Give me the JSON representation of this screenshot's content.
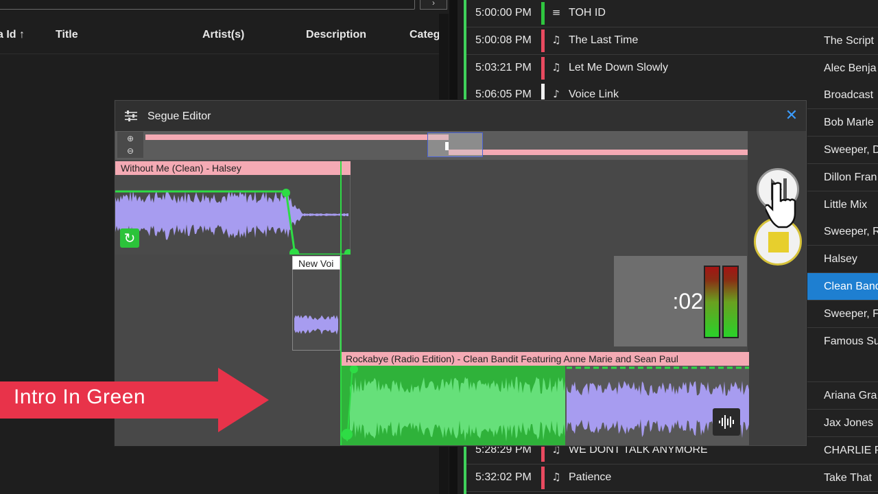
{
  "library": {
    "columns": [
      "a Id ↑",
      "Title",
      "Artist(s)",
      "Description",
      "Categ"
    ],
    "search_button": "›"
  },
  "playlist": {
    "rows": [
      {
        "time": "5:00:00 PM",
        "title": "TOH ID",
        "artist": "",
        "bar": "#2fc53f",
        "icon": "antenna-icon"
      },
      {
        "time": "5:00:08 PM",
        "title": "The Last Time",
        "artist": "The Script",
        "bar": "#e84a5f",
        "icon": "music-note-icon"
      },
      {
        "time": "5:03:21 PM",
        "title": "Let Me Down Slowly",
        "artist": "Alec Benja",
        "bar": "#e84a5f",
        "icon": "music-note-icon"
      },
      {
        "time": "5:06:05 PM",
        "title": "Voice Link",
        "artist": "Broadcast",
        "bar": "#f0f0f0",
        "icon": "microphone-icon"
      },
      {
        "time": "",
        "title": "",
        "artist": "Bob Marle",
        "bar": "",
        "icon": ""
      },
      {
        "time": "",
        "title": "",
        "artist": "Sweeper, D",
        "bar": "",
        "icon": ""
      },
      {
        "time": "",
        "title": "",
        "artist": "Dillon Fran",
        "bar": "",
        "icon": ""
      },
      {
        "time": "",
        "title": "",
        "artist": "Little Mix",
        "bar": "",
        "icon": ""
      },
      {
        "time": "",
        "title": "",
        "artist": "Sweeper, R",
        "bar": "",
        "icon": ""
      },
      {
        "time": "",
        "title": "",
        "artist": "Halsey",
        "bar": "",
        "icon": ""
      },
      {
        "time": "",
        "title": "",
        "artist": "Clean Band",
        "bar": "",
        "icon": ""
      },
      {
        "time": "",
        "title": "",
        "artist": "Sweeper, F",
        "bar": "",
        "icon": ""
      },
      {
        "time": "",
        "title": "",
        "artist": "Famous Su",
        "bar": "",
        "icon": ""
      },
      {
        "time": "",
        "title": "",
        "artist": "",
        "bar": "",
        "icon": ""
      },
      {
        "time": "",
        "title": "",
        "artist": "Ariana Gra",
        "bar": "",
        "icon": ""
      },
      {
        "time": "",
        "title": "",
        "artist": "Jax Jones",
        "bar": "",
        "icon": ""
      },
      {
        "time": "5:28:29 PM",
        "title": "WE DONT TALK ANYMORE",
        "artist": "CHARLIE P",
        "bar": "#e84a5f",
        "icon": "music-note-icon"
      },
      {
        "time": "5:32:02 PM",
        "title": "Patience",
        "artist": "Take That",
        "bar": "#e84a5f",
        "icon": "music-note-icon"
      }
    ],
    "selected_index": 10
  },
  "segue": {
    "title": "Segue Editor",
    "close": "✕",
    "track1_label": "Without Me (Clean) - Halsey",
    "track2_label": "New Voi",
    "track3_label": "Rockabye (Radio Edition) - Clean Bandit Featuring Anne Marie and Sean Paul",
    "countdown": ":02",
    "meter_levels": [
      1.0,
      1.0
    ]
  },
  "overlay": {
    "arrow_text": "Intro In Green",
    "arrow_color": "#e8334a"
  },
  "colors": {
    "accent_green": "#3fd15a",
    "track_pink": "#f4aab4",
    "waveform": "#a79cf0",
    "selected_blue": "#1e7fd1"
  }
}
